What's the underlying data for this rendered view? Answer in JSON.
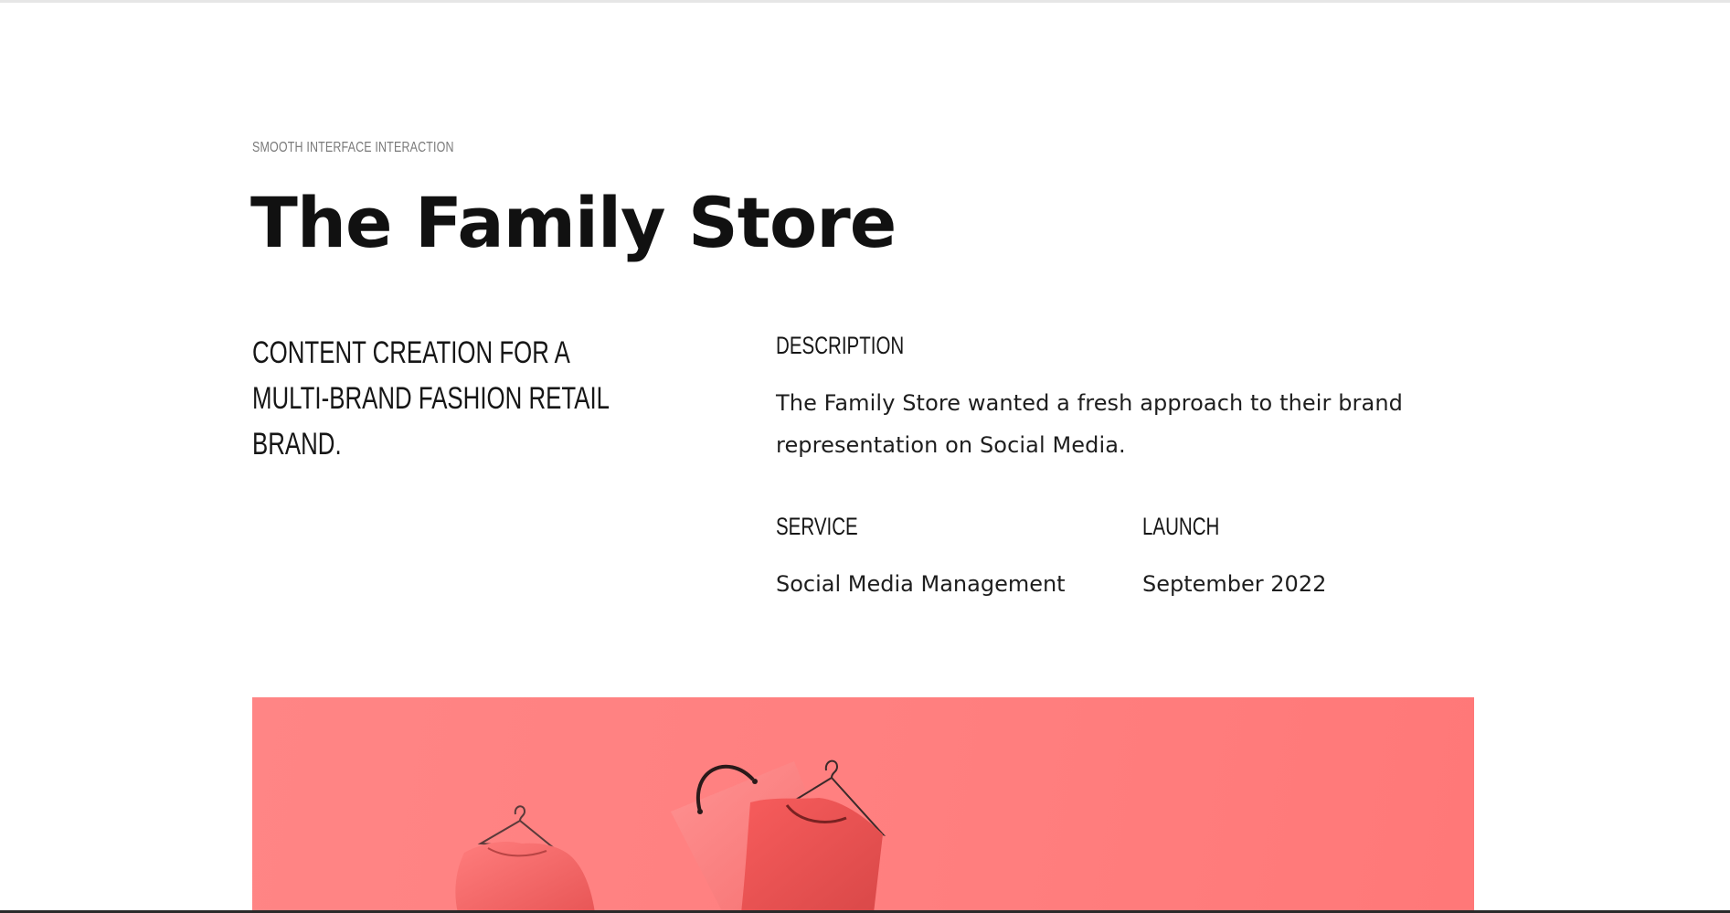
{
  "header": {
    "eyebrow": "SMOOTH INTERFACE INTERACTION",
    "title": "The Family Store"
  },
  "intro": {
    "tagline": "CONTENT CREATION FOR A MULTI-BRAND FASHION RETAIL BRAND."
  },
  "details": {
    "description_label": "DESCRIPTION",
    "description_text": "The Family Store wanted a fresh approach to their brand representation on Social Media.",
    "service_label": "SERVICE",
    "service_value": "Social Media Management",
    "launch_label": "LAUNCH",
    "launch_value": "September 2022"
  },
  "hero": {
    "background_color": "#ff7f7f",
    "icons": [
      "t-shirt-on-hanger-icon",
      "shopping-bag-icon",
      "dress-on-hanger-icon"
    ]
  }
}
